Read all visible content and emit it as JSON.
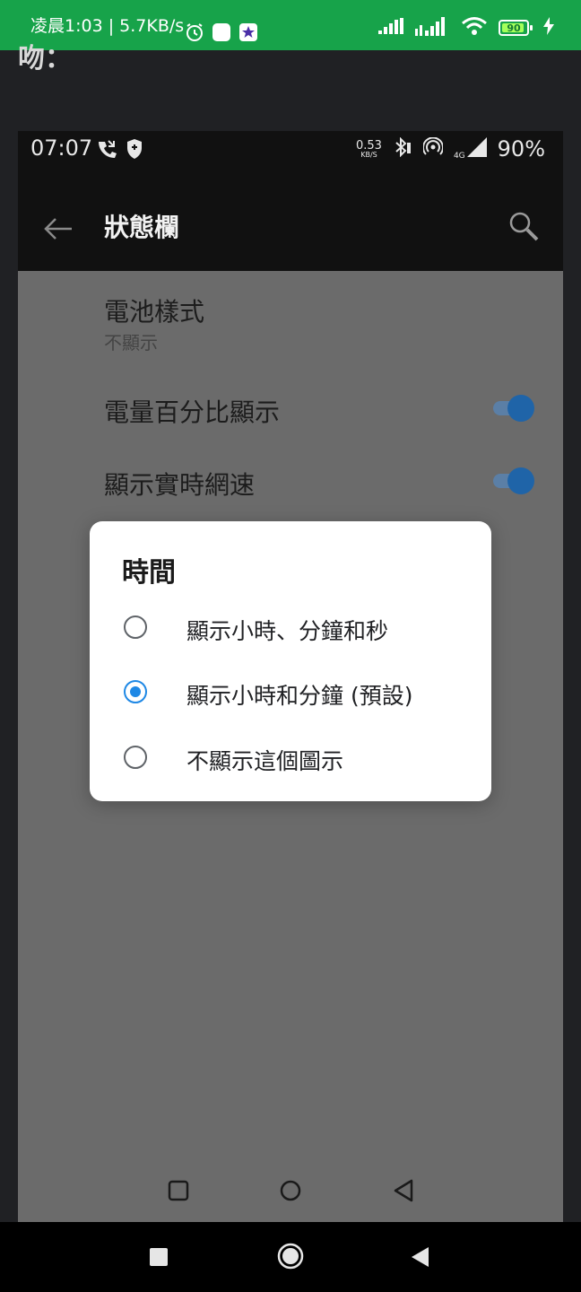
{
  "outer_status": {
    "time_speed": "凌晨1:03 | 5.7KB/s",
    "battery_level": "90",
    "icons": [
      "alarm-icon",
      "notification-square-icon",
      "star-app-icon",
      "signal-icon",
      "signal-4g-icon",
      "wifi-icon",
      "battery-icon",
      "charging-icon"
    ]
  },
  "article": {
    "fragment": "吻："
  },
  "inner_status": {
    "time": "07:07",
    "net_speed_value": "0.53",
    "net_speed_unit": "KB/S",
    "network_type": "4G",
    "battery_percent": "90%"
  },
  "toolbar": {
    "title": "狀態欄"
  },
  "settings": {
    "battery_style": {
      "title": "電池樣式",
      "value": "不顯示"
    },
    "battery_percentage": {
      "title": "電量百分比顯示",
      "enabled": true
    },
    "net_speed": {
      "title": "顯示實時網速",
      "enabled": true
    }
  },
  "dialog": {
    "title": "時間",
    "options": [
      {
        "label": "顯示小時、分鐘和秒",
        "selected": false
      },
      {
        "label": "顯示小時和分鐘 (預設)",
        "selected": true
      },
      {
        "label": "不顯示這個圖示",
        "selected": false
      }
    ]
  },
  "colors": {
    "outer_status_bg": "#17a34a",
    "accent": "#1e88e5",
    "toggle_thumb": "#1f64a8",
    "scrim_bg": "#6b6b6b"
  }
}
